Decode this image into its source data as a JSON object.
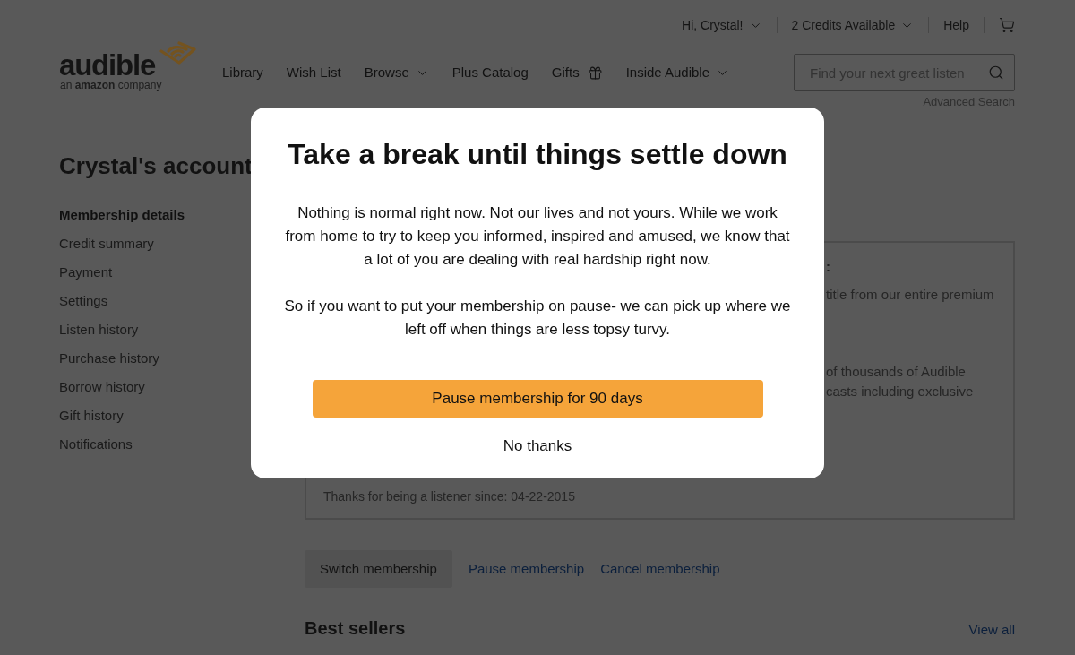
{
  "top_bar": {
    "items": [
      {
        "label": "Hi, Crystal!",
        "kind": "dropdown"
      },
      {
        "label": "2 Credits Available",
        "kind": "dropdown"
      },
      {
        "label": "Help",
        "kind": "link"
      },
      {
        "kind": "cart"
      }
    ]
  },
  "logo": {
    "wordmark": "audible",
    "tagline": "an **amazon** company"
  },
  "nav": [
    {
      "label": "Library",
      "kind": "link"
    },
    {
      "label": "Wish List",
      "kind": "link"
    },
    {
      "label": "Browse",
      "kind": "dropdown"
    },
    {
      "label": "Plus Catalog",
      "kind": "link"
    },
    {
      "label": "Gifts",
      "kind": "gift"
    },
    {
      "label": "Inside Audible",
      "kind": "dropdown"
    }
  ],
  "search": {
    "placeholder": "Find your next great listen",
    "advanced_link": "Advanced Search"
  },
  "sidebar": {
    "title": "Crystal's account",
    "items": [
      {
        "label": "Membership details",
        "selected": true
      },
      {
        "label": "Credit summary",
        "selected": false
      },
      {
        "label": "Payment",
        "selected": false
      },
      {
        "label": "Settings",
        "selected": false
      },
      {
        "label": "Listen history",
        "selected": false
      },
      {
        "label": "Purchase history",
        "selected": false
      },
      {
        "label": "Borrow history",
        "selected": false
      },
      {
        "label": "Gift history",
        "selected": false
      },
      {
        "label": "Notifications",
        "selected": false
      }
    ]
  },
  "membership_card": {
    "heading_fragment": ":",
    "benefits": [
      {
        "lines": [
          "title from our entire premium"
        ]
      },
      {
        "lines": [
          "of thousands of Audible",
          "casts including exclusive"
        ]
      }
    ],
    "footer": "Thanks for being a listener since: 04-22-2015"
  },
  "actions": [
    {
      "label": "Switch membership",
      "kind": "button"
    },
    {
      "label": "Pause membership",
      "kind": "link"
    },
    {
      "label": "Cancel membership",
      "kind": "link"
    }
  ],
  "best_sellers": {
    "title": "Best sellers",
    "link": "View all"
  },
  "modal": {
    "title": "Take a break until things settle down",
    "paragraphs": [
      "Nothing is normal right now. Not our lives and not yours. While we work from home to try to keep you informed, inspired and amused, we know that a lot of you are dealing with real hardship right now.",
      "So if you want to put your membership on pause- we can pick up where we left off when things are less topsy turvy."
    ],
    "primary_button": "Pause membership for 90 days",
    "secondary_button": "No thanks"
  }
}
